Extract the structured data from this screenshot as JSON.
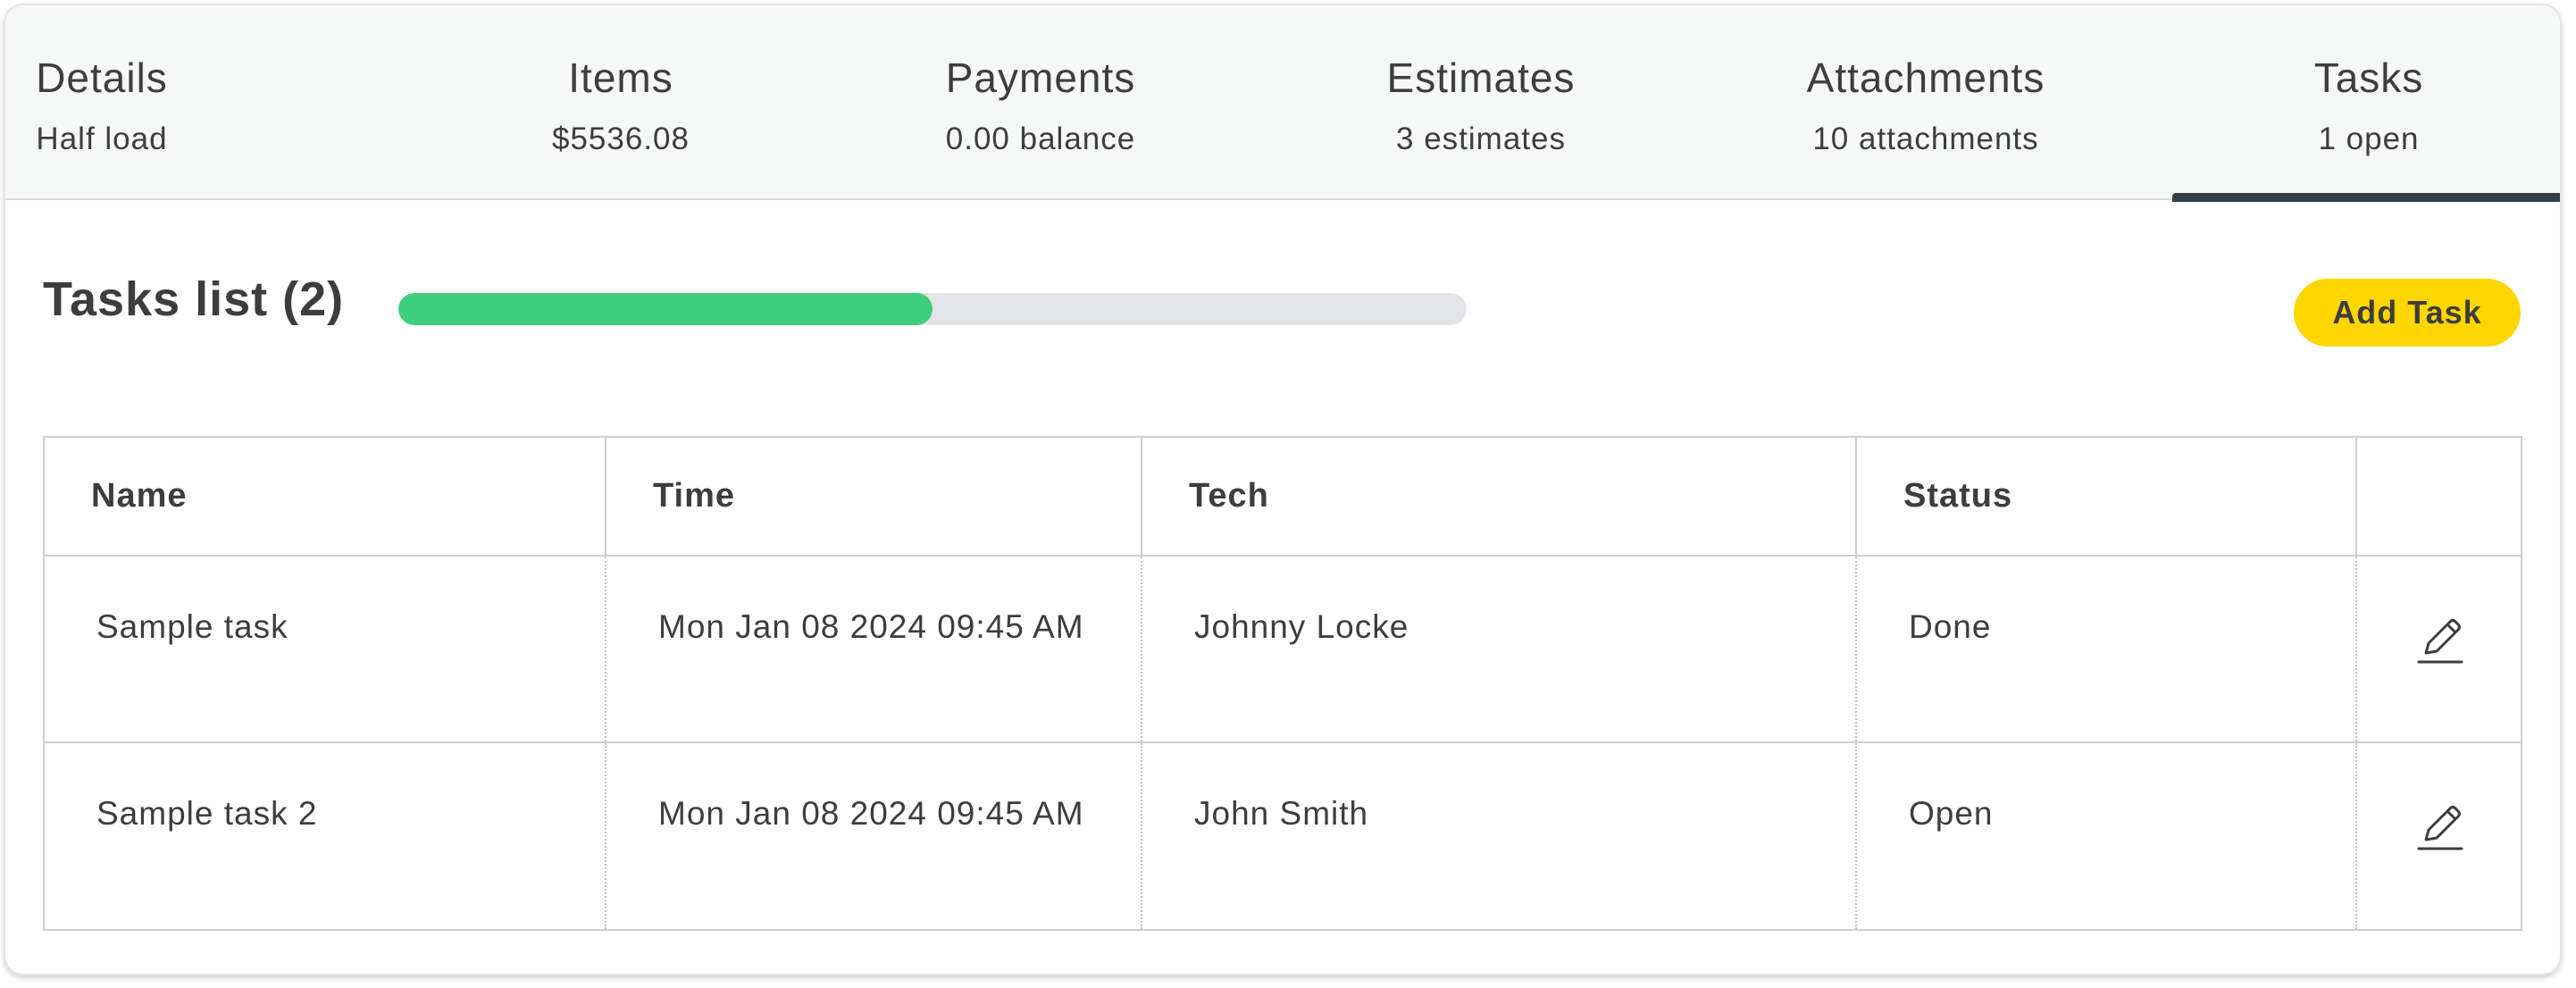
{
  "tabs": [
    {
      "title": "Details",
      "subtitle": "Half load",
      "active": false
    },
    {
      "title": "Items",
      "subtitle": "$5536.08",
      "active": false
    },
    {
      "title": "Payments",
      "subtitle": "0.00 balance",
      "active": false
    },
    {
      "title": "Estimates",
      "subtitle": "3 estimates",
      "active": false
    },
    {
      "title": "Attachments",
      "subtitle": "10 attachments",
      "active": false
    },
    {
      "title": "Tasks",
      "subtitle": "1 open",
      "active": true
    }
  ],
  "tasks": {
    "heading": "Tasks list (2)",
    "progress_percent": 50,
    "add_button_label": "Add Task",
    "columns": [
      "Name",
      "Time",
      "Tech",
      "Status",
      ""
    ],
    "rows": [
      {
        "name": "Sample task",
        "time": "Mon Jan 08 2024 09:45 AM",
        "tech": "Johnny Locke",
        "status": "Done",
        "action_icon": "pencil-icon"
      },
      {
        "name": "Sample task 2",
        "time": "Mon Jan 08 2024 09:45 AM",
        "tech": "John Smith",
        "status": "Open",
        "action_icon": "pencil-icon"
      }
    ]
  },
  "colors": {
    "progress_fill": "#3ecf7c",
    "progress_track": "#e3e4e5",
    "add_button_bg": "#ffd600",
    "active_tab_underline": "#353f48"
  }
}
